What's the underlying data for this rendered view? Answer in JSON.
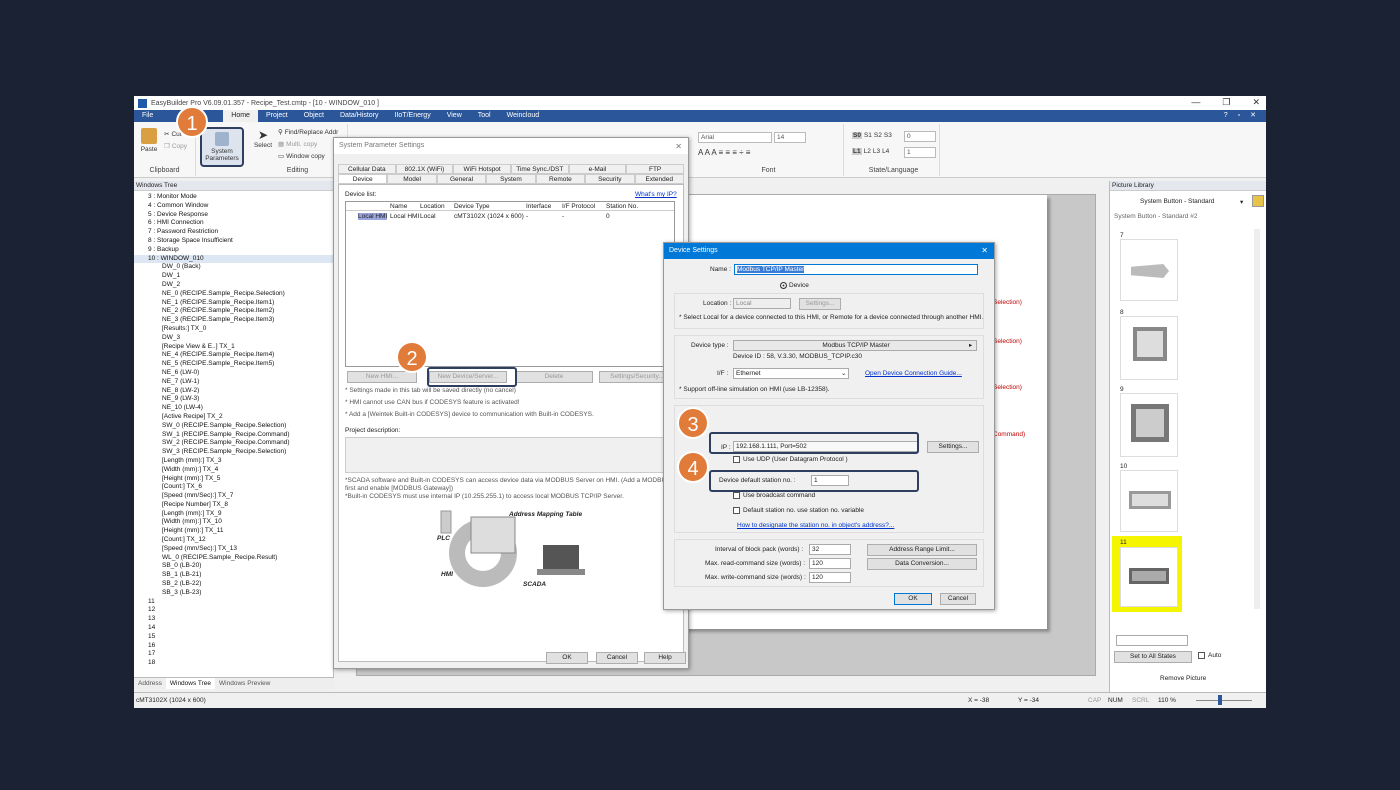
{
  "window": {
    "title": "EasyBuilder Pro V6.09.01.357 - Recipe_Test.cmtp - [10 - WINDOW_010 ]",
    "min": "—",
    "max": "❐",
    "close": "✕"
  },
  "menu": [
    "File",
    "Home",
    "Project",
    "Object",
    "Data/History",
    "IIoT/Energy",
    "View",
    "Tool",
    "Weincloud"
  ],
  "ribbon": {
    "paste": "Paste",
    "cut": "Cut",
    "copy": "Copy",
    "clipboard": "Clipboard",
    "system_parameters_1": "System",
    "system_parameters_2": "Parameters",
    "select": "Select",
    "find_replace": "Find/Replace Addr",
    "multi_copy": "Multi. copy",
    "window_copy": "Window copy",
    "editing": "Editing",
    "font_name": "Arial",
    "font_size": "14",
    "font": "Font",
    "state_row1": [
      "S0",
      "S1",
      "S2",
      "S3"
    ],
    "state_val1": "0",
    "lang_row": [
      "L1",
      "L2",
      "L3",
      "L4"
    ],
    "lang_val": "1",
    "state_language": "State/Language"
  },
  "left_panel": {
    "header": "Windows Tree",
    "items": [
      "3 : Monitor Mode",
      "4 : Common Window",
      "5 : Device Response",
      "6 : HMI Connection",
      "7 : Password Restriction",
      "8 : Storage Space Insufficient",
      "9 : Backup",
      "10 : WINDOW_010",
      "DW_0 (Back)",
      "DW_1",
      "DW_2",
      "NE_0 (RECIPE.Sample_Recipe.Selection)",
      "NE_1 (RECIPE.Sample_Recipe.Item1)",
      "NE_2 (RECIPE.Sample_Recipe.Item2)",
      "NE_3 (RECIPE.Sample_Recipe.Item3)",
      "[Results:] TX_0",
      "DW_3",
      "[Recipe View & E..] TX_1",
      "NE_4 (RECIPE.Sample_Recipe.Item4)",
      "NE_5 (RECIPE.Sample_Recipe.Item5)",
      "NE_6 (LW-0)",
      "NE_7 (LW-1)",
      "NE_8 (LW-2)",
      "NE_9 (LW-3)",
      "NE_10 (LW-4)",
      "[Active Recipe] TX_2",
      "SW_0 (RECIPE.Sample_Recipe.Selection)",
      "SW_1 (RECIPE.Sample_Recipe.Command)",
      "SW_2 (RECIPE.Sample_Recipe.Command)",
      "SW_3 (RECIPE.Sample_Recipe.Selection)",
      "[Length (mm):] TX_3",
      "[Width (mm):] TX_4",
      "[Height (mm):] TX_5",
      "[Count:] TX_6",
      "[Speed (mm/Sec):] TX_7",
      "[Recipe Number] TX_8",
      "[Length (mm):] TX_9",
      "[Width (mm):] TX_10",
      "[Height (mm):] TX_11",
      "[Count:] TX_12",
      "[Speed (mm/Sec):] TX_13",
      "WL_0 (RECIPE.Sample_Recipe.Result)",
      "SB_0 (LB-20)",
      "SB_1 (LB-21)",
      "SB_2 (LB-22)",
      "SB_3 (LB-23)",
      "11",
      "12",
      "13",
      "14",
      "15",
      "16",
      "17",
      "18"
    ],
    "tabs": [
      "Address",
      "Windows Tree",
      "Windows Preview"
    ]
  },
  "sys_dialog": {
    "title": "System Parameter Settings",
    "tabs_row1": [
      "Cellular Data Network",
      "802.1X (WiFi)",
      "WiFi Hotspot",
      "Time Sync./DST",
      "e-Mail",
      "FTP"
    ],
    "tabs_row2": [
      "Device",
      "Model",
      "General",
      "System",
      "Remote",
      "Security",
      "Extended Memory"
    ],
    "device_list": "Device list:",
    "whats_my_ip": "What's my IP?",
    "columns": [
      "Name",
      "Location",
      "Device Type",
      "Interface",
      "I/F Protocol",
      "Station No."
    ],
    "row": [
      "Local HMI",
      "Local HMI",
      "Local",
      "cMT3102X (1024 x 600)",
      "-",
      "-",
      "0"
    ],
    "buttons": [
      "New HMI...",
      "New Device/Server...",
      "Delete",
      "Settings/Security..."
    ],
    "note1": "* Settings made in this tab will be saved directly (no cancel)",
    "note2": "* HMI cannot use CAN bus if CODESYS feature is activated!",
    "note3": "* Add a [Weintek Built-in CODESYS] device to communication with Built-in CODESYS.",
    "project_desc": "Project description:",
    "scada1": "*SCADA software and Built-in CODESYS can access device data via MODBUS Server on HMI. (Add a MODBUS Ser",
    "scada2": "first and enable [MODBUS Gateway])",
    "scada3": "*Built-in CODESYS must use internal IP (10.255.255.1) to access local MODBUS TCP/IP Server.",
    "diagram": {
      "table": "Address Mapping Table",
      "plc": "PLC",
      "hmi": "HMI",
      "scada": "SCADA"
    },
    "ok": "OK",
    "cancel": "Cancel",
    "help": "Help"
  },
  "dev_dialog": {
    "title": "Device Settings",
    "name_label": "Name :",
    "name_value": "Modbus TCP/IP Master",
    "device_radio": "Device",
    "location_label": "Location :",
    "location_value": "Local",
    "location_settings": "Settings...",
    "location_note": "* Select Local for a device connected to this HMI, or Remote for a device connected through another HMI.",
    "type_label": "Device type :",
    "type_value": "Modbus TCP/IP Master",
    "device_id": "Device ID : 58, V.3.30, MODBUS_TCPIP.c30",
    "if_label": "I/F :",
    "if_value": "Ethernet",
    "guide_link": "Open Device Connection Guide...",
    "offline_note": "* Support off-line simulation on HMI (use LB-12358).",
    "ip_label": "IP :",
    "ip_value": "192.168.1.111, Port=502",
    "ip_settings": "Settings...",
    "use_udp": "Use UDP (User Datagram Protocol )",
    "station_label": "Device default station no. :",
    "station_value": "1",
    "broadcast": "Use broadcast command",
    "default_station": "Default station no. use station no. variable",
    "designate_link": "How to designate the station no. in object's address?...",
    "block_label": "Interval of block pack (words) :",
    "block_value": "32",
    "read_label": "Max. read-command size (words) :",
    "read_value": "120",
    "write_label": "Max. write-command size (words) :",
    "write_value": "120",
    "range_btn": "Address Range Limit...",
    "conv_btn": "Data Conversion...",
    "ok": "OK",
    "cancel": "Cancel"
  },
  "canvas_red": [
    "Selection)",
    "Selection)",
    "Selection)",
    "Command)"
  ],
  "right_panel": {
    "header": "Picture Library",
    "dropdown": "System Button - Standard",
    "subtitle": "System Button - Standard #2",
    "thumbs": [
      "7",
      "8",
      "9",
      "10",
      "11"
    ],
    "set_all": "Set to All States",
    "auto": "Auto",
    "remove": "Remove Picture"
  },
  "status": {
    "model": "cMT3102X (1024 x 600)",
    "x": "X = -38",
    "y": "Y = -34",
    "cap": "CAP",
    "num": "NUM",
    "scrl": "SCRL",
    "zoom": "110 %"
  },
  "badges": [
    "1",
    "2",
    "3",
    "4"
  ],
  "colors": {
    "accent": "#2b579a",
    "badge": "#e07b39",
    "highlight_yellow": "#f5f500",
    "dialog_title_blue": "#0078d7"
  }
}
